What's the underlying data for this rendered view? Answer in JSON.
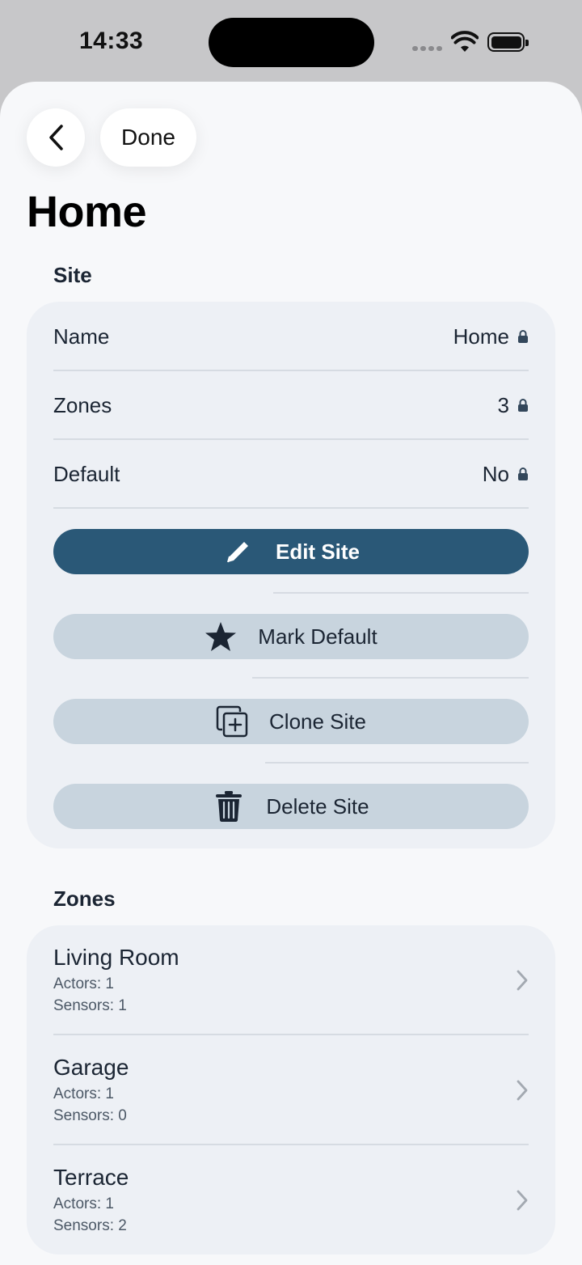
{
  "status_bar": {
    "time": "14:33"
  },
  "nav": {
    "done_label": "Done"
  },
  "page": {
    "title": "Home"
  },
  "site_section": {
    "header": "Site",
    "rows": [
      {
        "label": "Name",
        "value": "Home"
      },
      {
        "label": "Zones",
        "value": "3"
      },
      {
        "label": "Default",
        "value": "No"
      }
    ],
    "actions": [
      {
        "label": "Edit Site",
        "icon": "pencil-icon",
        "style": "primary"
      },
      {
        "label": "Mark Default",
        "icon": "star-icon",
        "style": "secondary"
      },
      {
        "label": "Clone Site",
        "icon": "clone-icon",
        "style": "secondary"
      },
      {
        "label": "Delete Site",
        "icon": "trash-icon",
        "style": "secondary"
      }
    ]
  },
  "zones_section": {
    "header": "Zones",
    "items": [
      {
        "name": "Living Room",
        "actors": "Actors: 1",
        "sensors": "Sensors: 1"
      },
      {
        "name": "Garage",
        "actors": "Actors: 1",
        "sensors": "Sensors: 0"
      },
      {
        "name": "Terrace",
        "actors": "Actors: 1",
        "sensors": "Sensors: 2"
      }
    ]
  },
  "colors": {
    "primary": "#2a5877",
    "secondary_button": "#c8d4de",
    "card": "#edf0f5",
    "background": "#f7f8fa"
  }
}
